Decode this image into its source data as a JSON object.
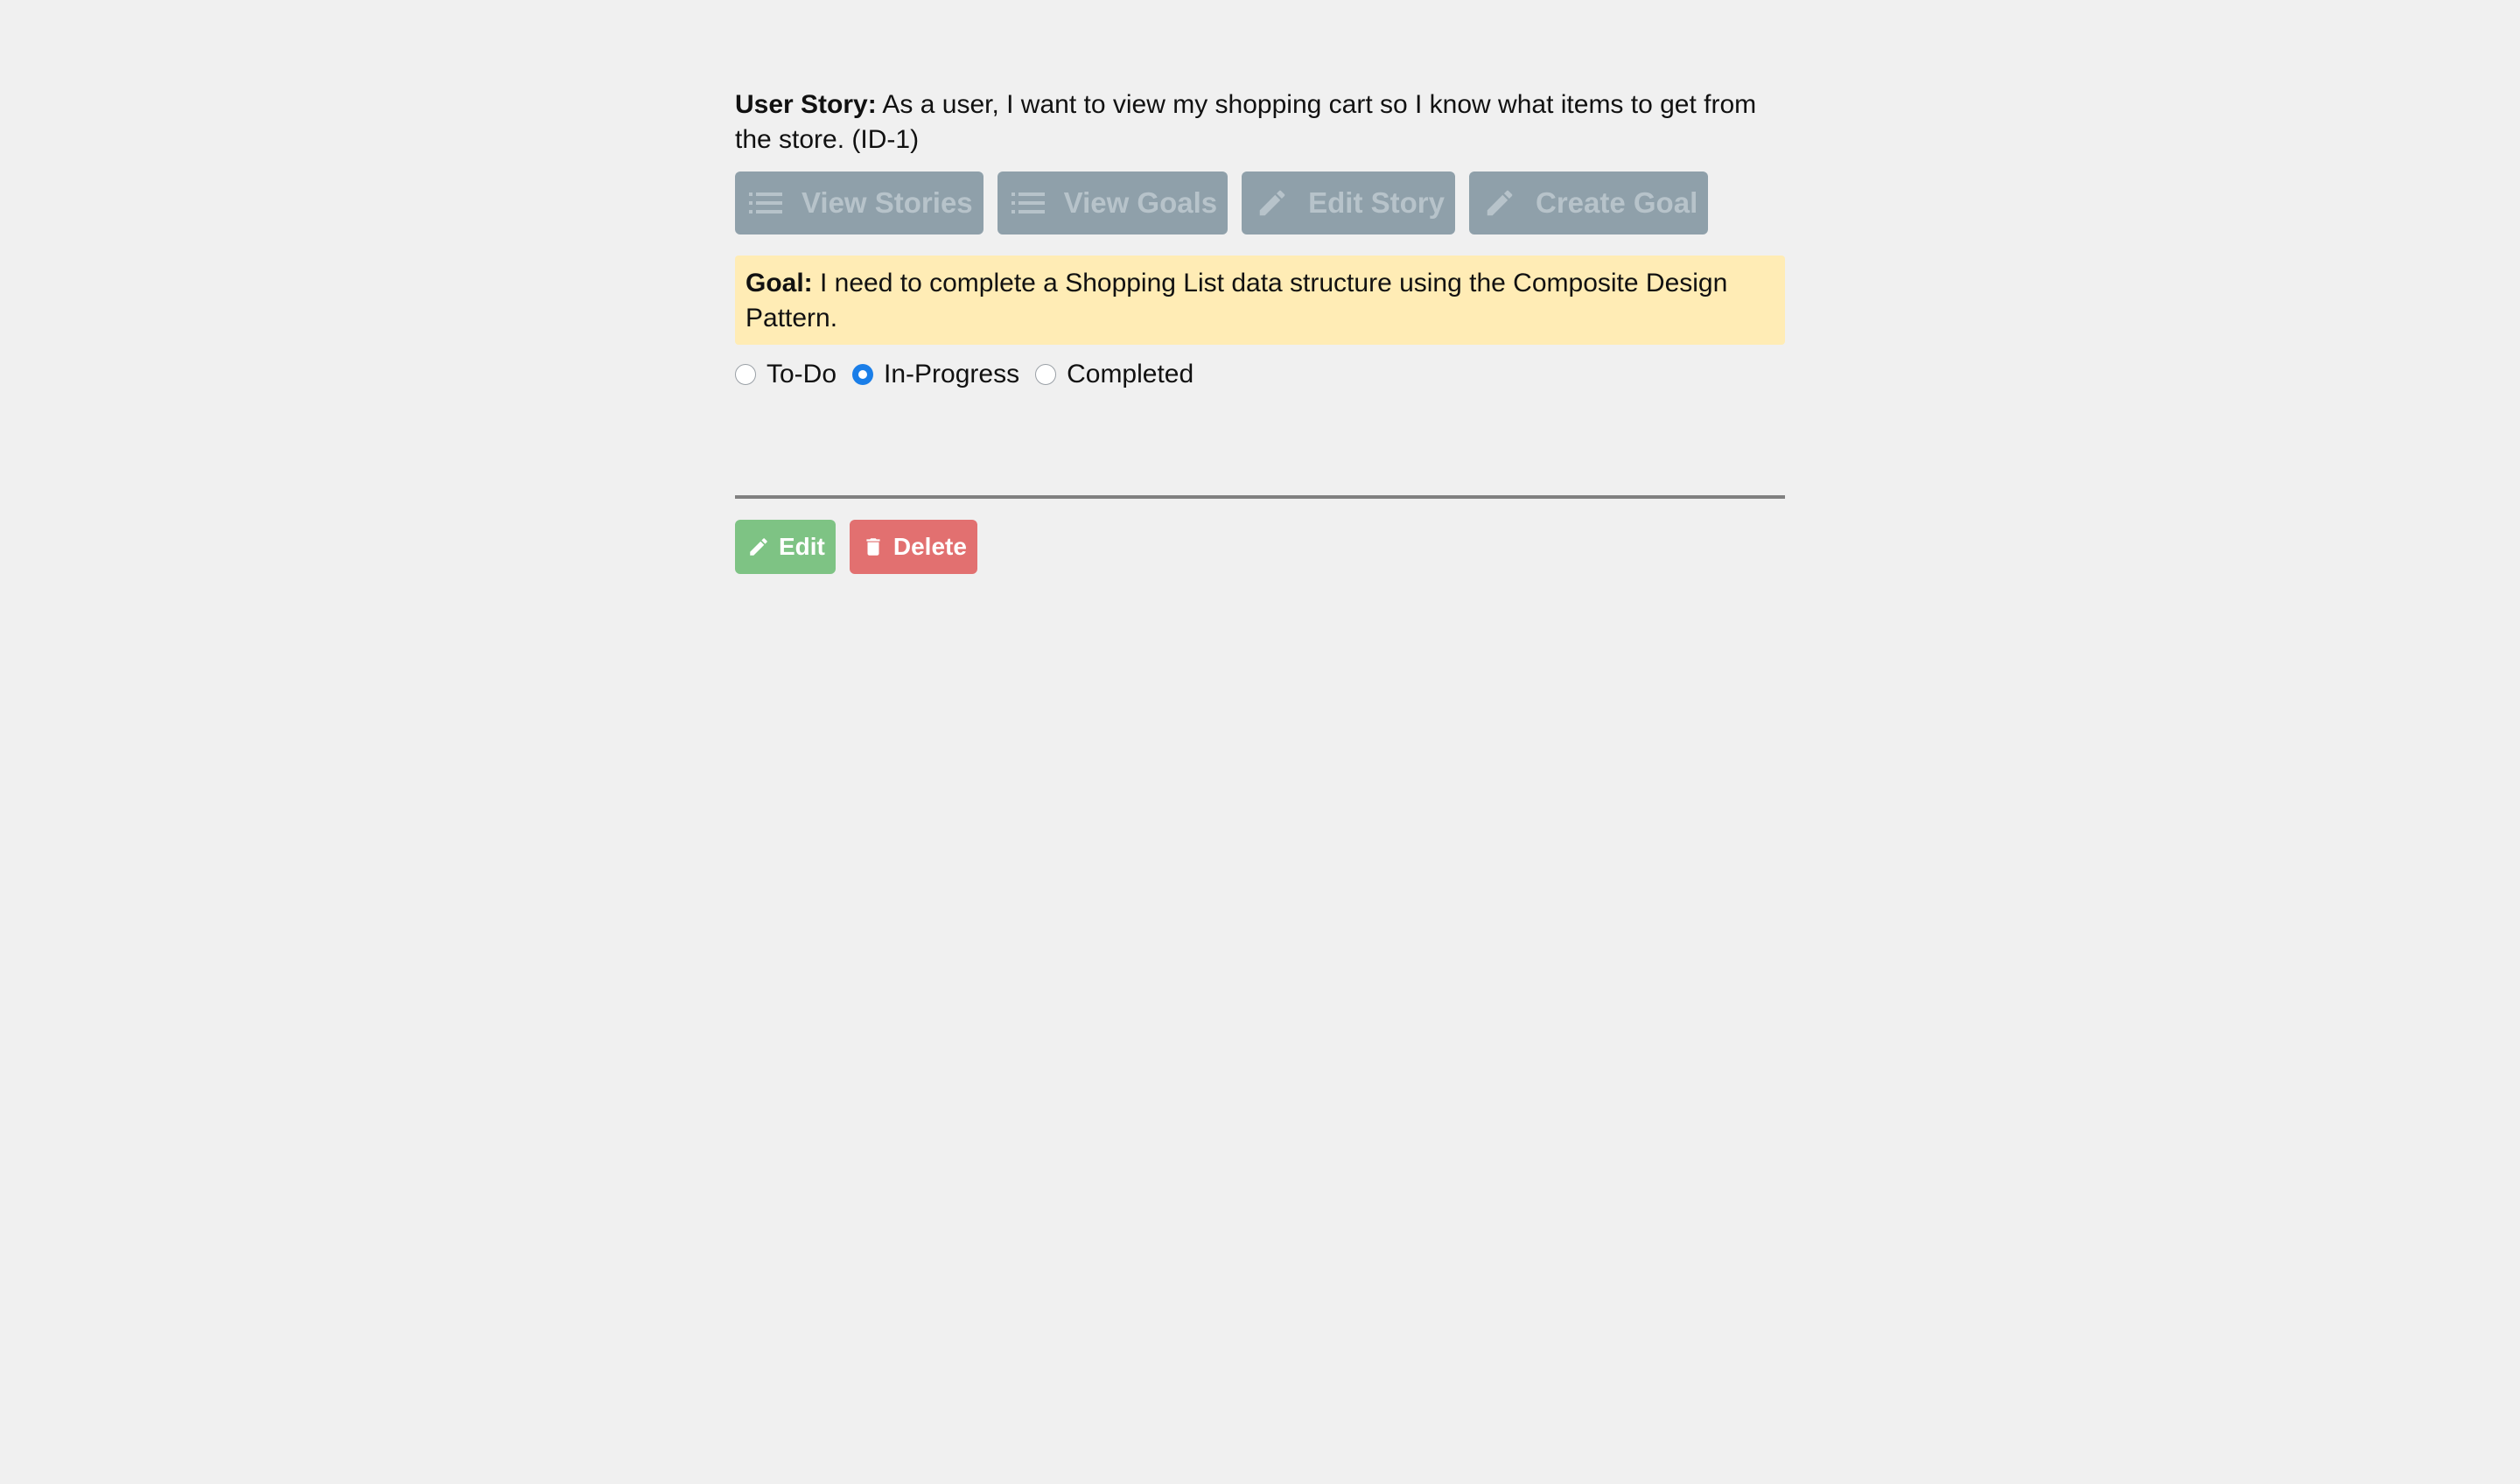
{
  "story": {
    "label": "User Story:",
    "text": " As a user, I want to view my shopping cart so I know what items to get from the store. (ID-1)"
  },
  "nav": {
    "view_stories": "View Stories",
    "view_goals": "View Goals",
    "edit_story": "Edit Story",
    "create_goal": "Create Goal"
  },
  "goal": {
    "label": "Goal:",
    "text": " I need to complete a Shopping List data structure using the Composite Design Pattern."
  },
  "status": {
    "options": [
      "To-Do",
      "In-Progress",
      "Completed"
    ],
    "selected": "In-Progress"
  },
  "actions": {
    "edit": "Edit",
    "delete": "Delete"
  },
  "icons": {
    "list": "list-icon",
    "pencil": "pencil-icon",
    "trash": "trash-icon"
  },
  "colors": {
    "background": "#f0f0f0",
    "nav_button": "#8fa0aa",
    "goal_highlight": "#ffecb5",
    "radio_checked": "#1a7ee8",
    "edit_button": "#7ec384",
    "delete_button": "#e27070"
  }
}
